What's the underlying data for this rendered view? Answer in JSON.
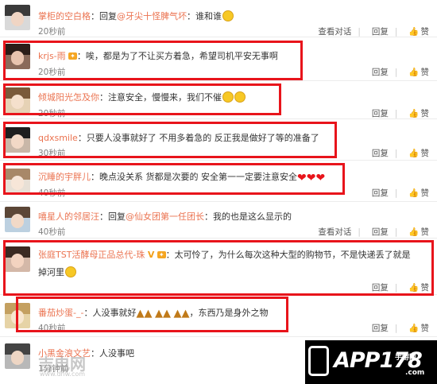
{
  "actions": {
    "view_thread": "查看对话",
    "reply": "回复",
    "like": "赞"
  },
  "comments": [
    {
      "user": "掌柜的空白格",
      "sep": "：",
      "reply_prefix": "回复",
      "mention": "@牙尖十怪脾气坏",
      "text": "：谁和谁",
      "time": "20秒前",
      "show_thread": true
    },
    {
      "user": "krjs-雨",
      "sep": "：",
      "text": "唉，都是为了不让买方着急，希望司机平安无事啊",
      "time": "20秒前",
      "show_thread": false
    },
    {
      "user": "倾城阳光怎及你",
      "sep": "：",
      "text": "注意安全，慢慢来，我们不催",
      "time": "20秒前",
      "show_thread": false
    },
    {
      "user": "qdxsmile",
      "sep": "：",
      "text": "只要人没事就好了 不用多着急的 反正我是做好了等的准备了",
      "time": "30秒前",
      "show_thread": false
    },
    {
      "user": "沉睡的宇胖儿",
      "sep": "：",
      "text": "晚点没关系 货都是次要的 安全第一一定要注意安全",
      "time": "40秒前",
      "show_thread": false
    },
    {
      "user": "嘻星人的邻居汪",
      "sep": "：",
      "reply_prefix": "回复",
      "mention": "@仙女团第一任团长",
      "text": "：我的也是这么显示的",
      "time": "40秒前",
      "show_thread": true
    },
    {
      "user": "张庭TST活酵母正品总代-珠",
      "badge": "V",
      "sep": "：",
      "text": "太可怜了，为什么每次这种大型的购物节，不是快递丢了就是",
      "text2": "掉河里",
      "time": "",
      "show_thread": false
    },
    {
      "user": "番茄炒蛋-_-",
      "sep": "：",
      "text": "人没事就好",
      "text_after": "，东西乃是身外之物",
      "time": "40秒前",
      "show_thread": false
    },
    {
      "user": "小黑金浪文艺",
      "sep": "：",
      "text": "人没事吧",
      "time": "1分钟前",
      "show_thread": false
    }
  ],
  "watermark_left": {
    "text": "吉电网",
    "subtext": "www.dnw.com"
  },
  "logo": {
    "text": "APP178",
    "subtext": "手游网",
    "domain": ".com"
  },
  "colors": {
    "highlight_box": "#e8141b",
    "username": "#eb7350",
    "accent": "#f7c825"
  },
  "icons": [
    "laugh-emoji",
    "heart-emoji",
    "pray-emoji",
    "thumb-up-icon",
    "phone-icon"
  ]
}
